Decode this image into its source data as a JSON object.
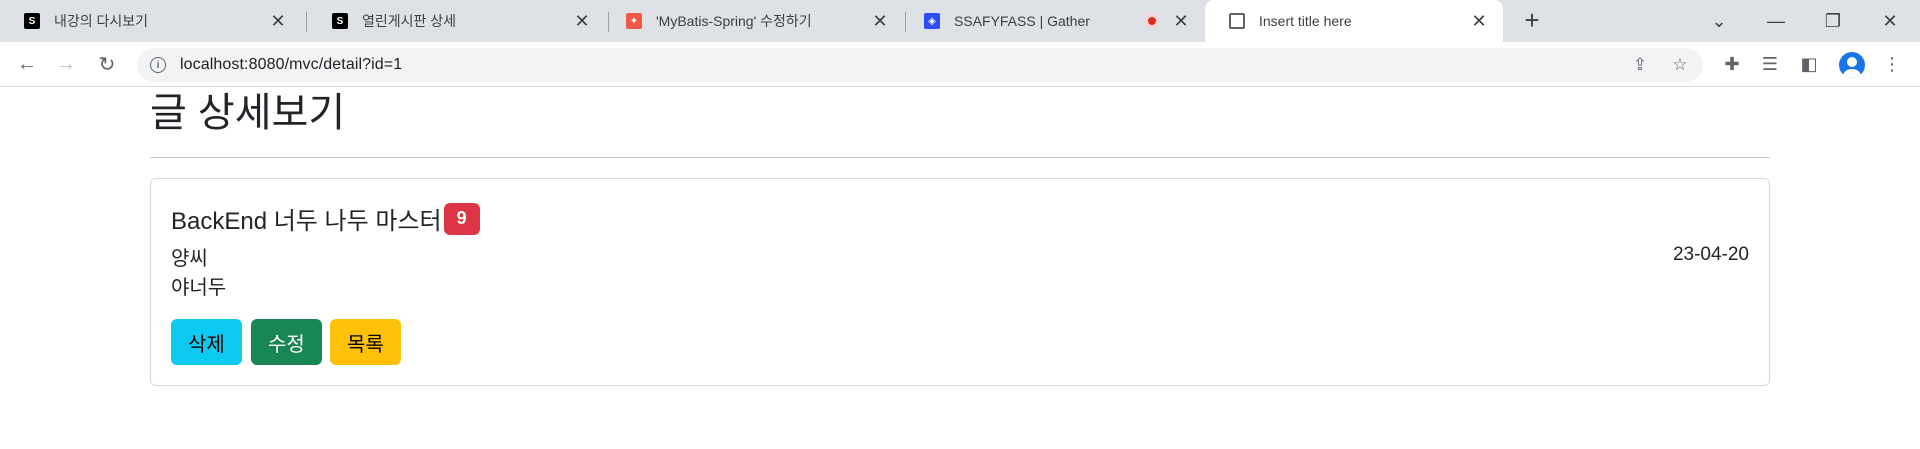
{
  "browser": {
    "tabs": [
      {
        "title": "내강의 다시보기",
        "favicon": "ssafy-icon"
      },
      {
        "title": "열린게시판 상세",
        "favicon": "ssafy-icon"
      },
      {
        "title": "'MyBatis-Spring' 수정하기",
        "favicon": "notion-red-icon"
      },
      {
        "title": "SSAFYFASS | Gather",
        "favicon": "gather-icon"
      },
      {
        "title": "Insert title here",
        "favicon": "globe-icon",
        "active": true
      }
    ],
    "url": "localhost:8080/mvc/detail?id=1"
  },
  "page": {
    "heading": "글 상세보기"
  },
  "post": {
    "title": "BackEnd 너두 나두 마스터",
    "view_count": "9",
    "writer": "양씨",
    "content": "야너두",
    "date": "23-04-20"
  },
  "buttons": {
    "delete": "삭제",
    "edit": "수정",
    "list": "목록"
  },
  "colors": {
    "badge": "#dc3545",
    "delete_btn": "#0dcaf0",
    "edit_btn": "#198754",
    "list_btn": "#ffc107"
  }
}
